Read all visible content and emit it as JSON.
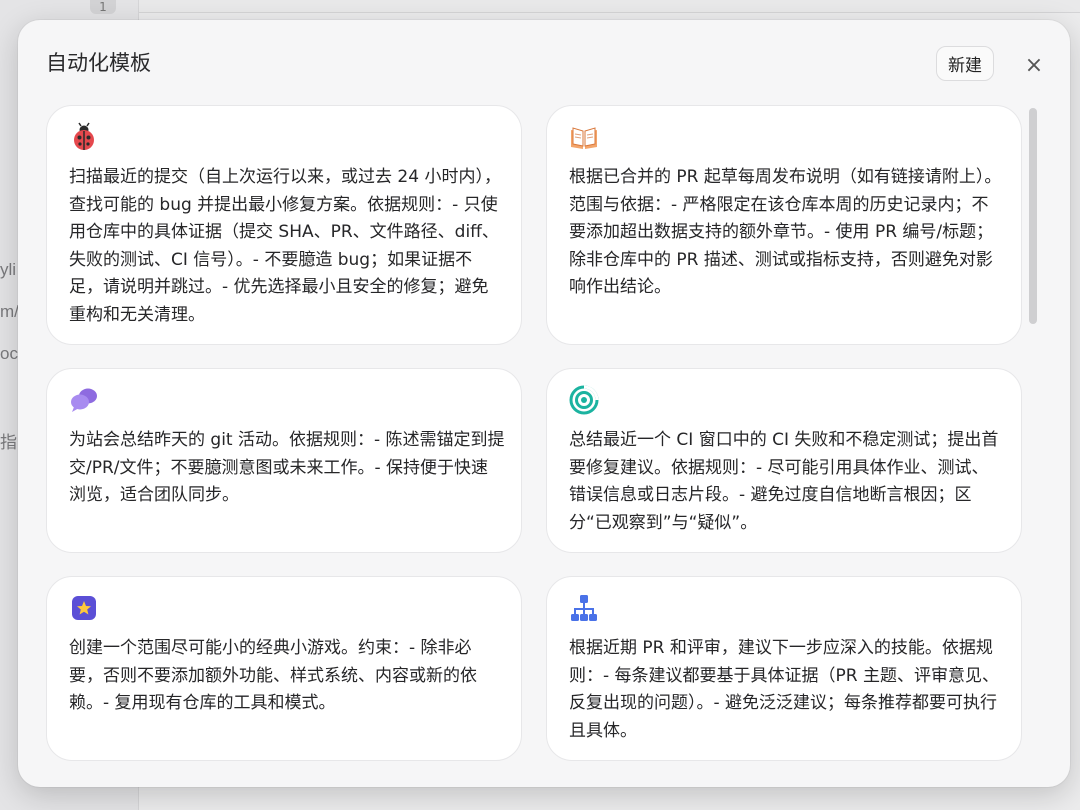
{
  "background": {
    "badge": "1",
    "fragments": [
      "yli",
      "m/",
      "ocu",
      "指南"
    ]
  },
  "modal": {
    "title": "自动化模板",
    "new_button": "新建",
    "close_symbol": "×"
  },
  "templates": [
    {
      "icon": "ladybug-icon",
      "text": "扫描最近的提交（自上次运行以来，或过去 24 小时内），查找可能的 bug 并提出最小修复方案。依据规则：- 只使用仓库中的具体证据（提交 SHA、PR、文件路径、diff、失败的测试、CI 信号）。- 不要臆造 bug；如果证据不足，请说明并跳过。- 优先选择最小且安全的修复；避免重构和无关清理。"
    },
    {
      "icon": "open-book-icon",
      "text": "根据已合并的 PR 起草每周发布说明（如有链接请附上）。范围与依据：- 严格限定在该仓库本周的历史记录内；不要添加超出数据支持的额外章节。- 使用 PR 编号/标题；除非仓库中的 PR 描述、测试或指标支持，否则避免对影响作出结论。"
    },
    {
      "icon": "chat-bubbles-icon",
      "text": "为站会总结昨天的 git 活动。依据规则：- 陈述需锚定到提交/PR/文件；不要臆测意图或未来工作。- 保持便于快速浏览，适合团队同步。"
    },
    {
      "icon": "target-icon",
      "text": "总结最近一个 CI 窗口中的 CI 失败和不稳定测试；提出首要修复建议。依据规则：- 尽可能引用具体作业、测试、错误信息或日志片段。- 避免过度自信地断言根因；区分“已观察到”与“疑似”。"
    },
    {
      "icon": "star-badge-icon",
      "text": "创建一个范围尽可能小的经典小游戏。约束：- 除非必要，否则不要添加额外功能、样式系统、内容或新的依赖。- 复用现有仓库的工具和模式。"
    },
    {
      "icon": "hierarchy-icon",
      "text": "根据近期 PR 和评审，建议下一步应深入的技能。依据规则：- 每条建议都要基于具体证据（PR 主题、评审意见、反复出现的问题）。- 避免泛泛建议；每条推荐都要可执行且具体。"
    }
  ]
}
